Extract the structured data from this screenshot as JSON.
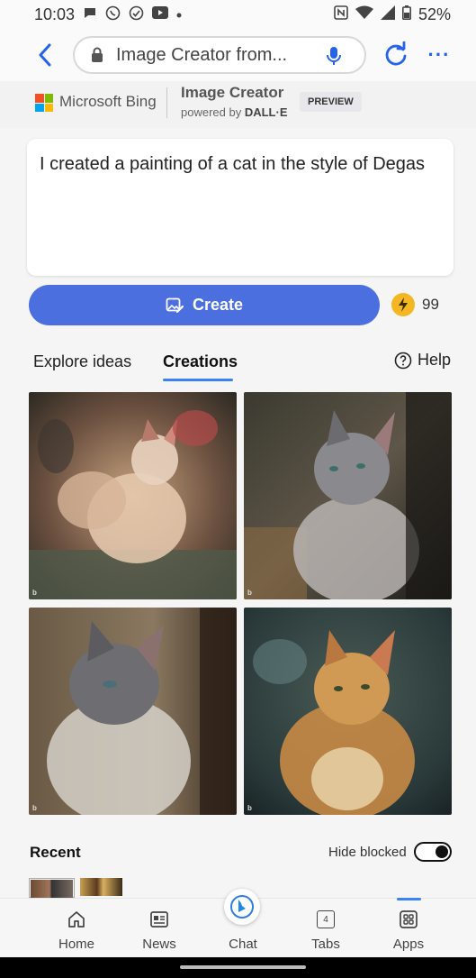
{
  "status_bar": {
    "time": "10:03",
    "battery": "52%"
  },
  "browser": {
    "url_text": "Image Creator from...",
    "more_label": "···"
  },
  "header": {
    "brand": "Microsoft Bing",
    "title": "Image Creator",
    "powered_prefix": "powered by ",
    "powered_name": "DALL·E",
    "badge": "PREVIEW"
  },
  "prompt": {
    "text": "I created a painting of a cat in the style of Degas"
  },
  "create": {
    "label": "Create",
    "boosts": "99"
  },
  "tabs": {
    "explore": "Explore ideas",
    "creations": "Creations",
    "help": "Help"
  },
  "images": [
    {
      "mark": "b"
    },
    {
      "mark": "b"
    },
    {
      "mark": "b"
    },
    {
      "mark": "b"
    }
  ],
  "recent": {
    "label": "Recent",
    "hide_blocked": "Hide blocked",
    "hide_blocked_on": true
  },
  "bottom_nav": {
    "home": "Home",
    "news": "News",
    "chat": "Chat",
    "tabs": "Tabs",
    "tabs_count": "4",
    "apps": "Apps"
  },
  "colors": {
    "accent": "#4c6fe0",
    "link_blue": "#2563eb",
    "boost": "#f5b623"
  }
}
